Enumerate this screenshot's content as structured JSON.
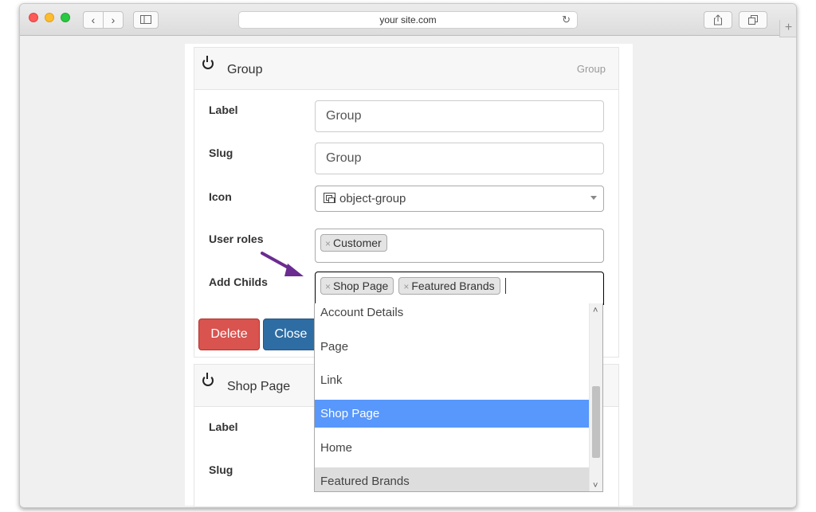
{
  "browser": {
    "address": "your site.com"
  },
  "panel1": {
    "title": "Group",
    "tag": "Group",
    "label_label": "Label",
    "label_value": "Group",
    "slug_label": "Slug",
    "slug_value": "Group",
    "icon_label": "Icon",
    "icon_value": "object-group",
    "user_roles_label": "User roles",
    "user_roles": [
      "Customer"
    ],
    "add_childs_label": "Add Childs",
    "add_childs": [
      "Shop Page",
      "Featured Brands"
    ],
    "delete_label": "Delete",
    "close_label": "Close"
  },
  "panel2": {
    "title": "Shop Page",
    "label_label": "Label",
    "slug_label": "Slug"
  },
  "dropdown": {
    "options": [
      "Account Details",
      "Page",
      "Link",
      "Shop Page",
      "Home",
      "Featured Brands"
    ],
    "highlighted": "Shop Page",
    "selected": [
      "Featured Brands"
    ]
  },
  "colors": {
    "delete": "#d9534f",
    "close": "#2e6da4",
    "highlight": "#5897fb",
    "annotation_arrow": "#6a2c91"
  }
}
